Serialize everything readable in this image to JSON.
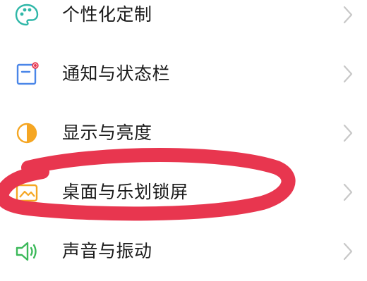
{
  "settings": {
    "items": [
      {
        "label": "个性化定制",
        "icon": "palette-icon",
        "icon_color": "#2fb7a8"
      },
      {
        "label": "通知与状态栏",
        "icon": "notification-icon",
        "icon_color": "#4a86e8"
      },
      {
        "label": "显示与亮度",
        "icon": "brightness-icon",
        "icon_color": "#f5a623"
      },
      {
        "label": "桌面与乐划锁屏",
        "icon": "desktop-icon",
        "icon_color": "#f5a623"
      },
      {
        "label": "声音与振动",
        "icon": "sound-icon",
        "icon_color": "#3cb95a"
      }
    ]
  },
  "colors": {
    "label_text": "#1a1a1a",
    "chevron": "#c8c8c8",
    "annotation_ring": "#e8364f"
  }
}
